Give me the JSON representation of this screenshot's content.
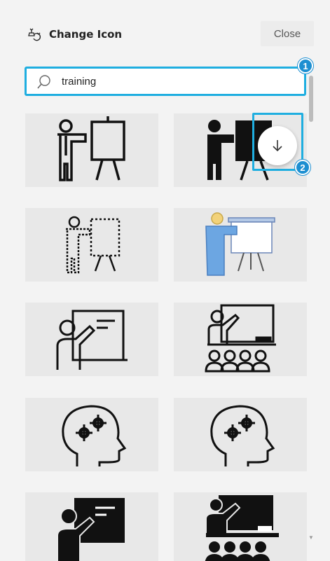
{
  "header": {
    "title": "Change Icon",
    "icon": "change-icon-icon",
    "close_label": "Close"
  },
  "search": {
    "value": "training",
    "icon": "search-icon"
  },
  "badges": [
    "1",
    "2"
  ],
  "scroll_button": {
    "icon": "arrow-down-icon"
  },
  "results": [
    {
      "name": "presenter-easel-outline-icon"
    },
    {
      "name": "presenter-easel-filled-icon"
    },
    {
      "name": "presenter-board-dotted-icon"
    },
    {
      "name": "presenter-screen-color-icon"
    },
    {
      "name": "teacher-board-outline-icon"
    },
    {
      "name": "classroom-teacher-students-icon"
    },
    {
      "name": "head-gears-icon"
    },
    {
      "name": "head-gears-outline-icon"
    },
    {
      "name": "teacher-board-filled-icon"
    },
    {
      "name": "classroom-filled-icon"
    }
  ],
  "colors": {
    "accent": "#1faee0",
    "badge": "#1d8fd1",
    "tile_bg": "#e8e8e8",
    "panel_bg": "#f3f3f3"
  }
}
